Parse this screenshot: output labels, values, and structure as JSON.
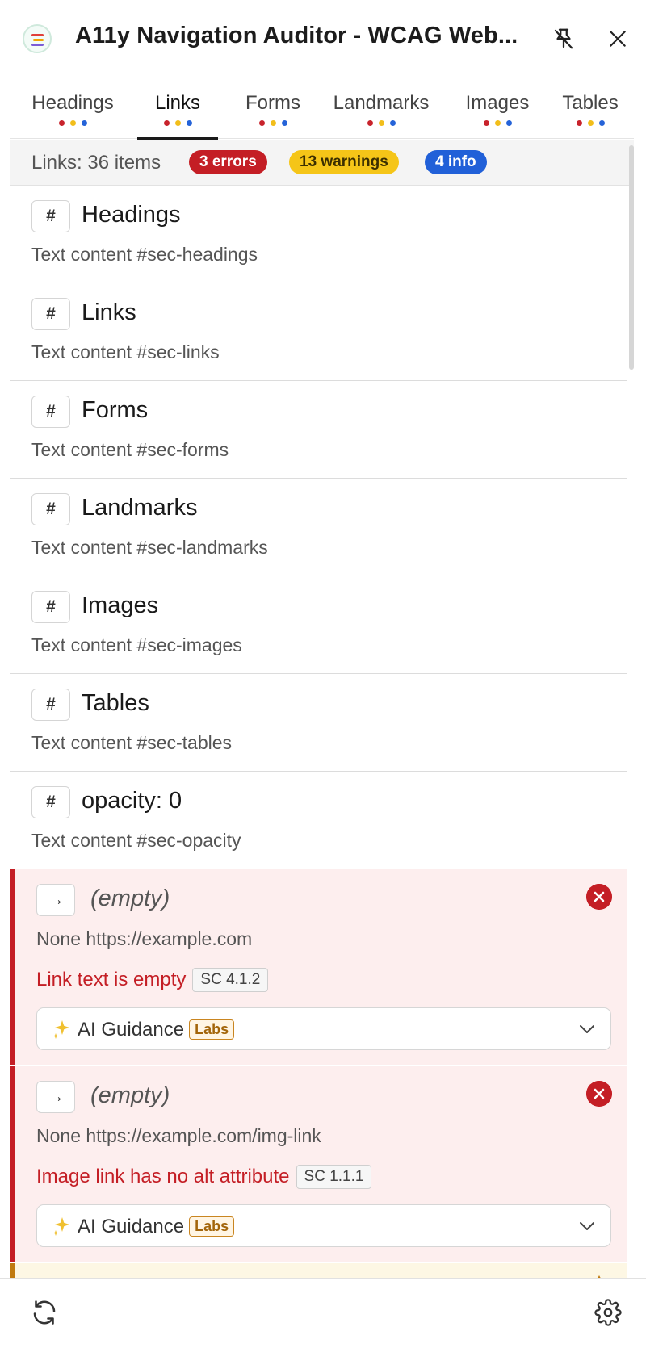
{
  "header": {
    "title": "A11y Navigation Auditor - WCAG Web...",
    "icons": {
      "app": "app-logo-icon",
      "pin": "unpin-icon",
      "close": "close-icon"
    }
  },
  "tabs": [
    {
      "label": "Headings",
      "active": false
    },
    {
      "label": "Links",
      "active": true
    },
    {
      "label": "Forms",
      "active": false
    },
    {
      "label": "Landmarks",
      "active": false
    },
    {
      "label": "Images",
      "active": false
    },
    {
      "label": "Tables",
      "active": false
    }
  ],
  "summary": {
    "text": "Links: 36 items",
    "errors": "3 errors",
    "warnings": "13 warnings",
    "info": "4 info"
  },
  "items": [
    {
      "icon": "#",
      "title": "Headings",
      "meta": "Text content  #sec-headings"
    },
    {
      "icon": "#",
      "title": "Links",
      "meta": "Text content  #sec-links"
    },
    {
      "icon": "#",
      "title": "Forms",
      "meta": "Text content  #sec-forms"
    },
    {
      "icon": "#",
      "title": "Landmarks",
      "meta": "Text content  #sec-landmarks"
    },
    {
      "icon": "#",
      "title": "Images",
      "meta": "Text content  #sec-images"
    },
    {
      "icon": "#",
      "title": "Tables",
      "meta": "Text content  #sec-tables"
    },
    {
      "icon": "#",
      "title": "opacity: 0",
      "meta": "Text content  #sec-opacity"
    }
  ],
  "issues": [
    {
      "icon": "→",
      "title": "(empty)",
      "meta": "None  https://example.com",
      "message": "Link text is empty",
      "sc": "SC 4.1.2",
      "ai_label": "AI Guidance",
      "labs": "Labs"
    },
    {
      "icon": "→",
      "title": "(empty)",
      "meta": "None  https://example.com/img-link",
      "message": "Image link has no alt attribute",
      "sc": "SC 1.1.1",
      "ai_label": "AI Guidance",
      "labs": "Labs"
    }
  ],
  "colors": {
    "error": "#c41e25",
    "warning": "#f5c518",
    "info": "#2160d8",
    "error_bg": "#fdeeee"
  },
  "footer": {
    "refresh_icon": "refresh-icon",
    "settings_icon": "gear-icon"
  }
}
